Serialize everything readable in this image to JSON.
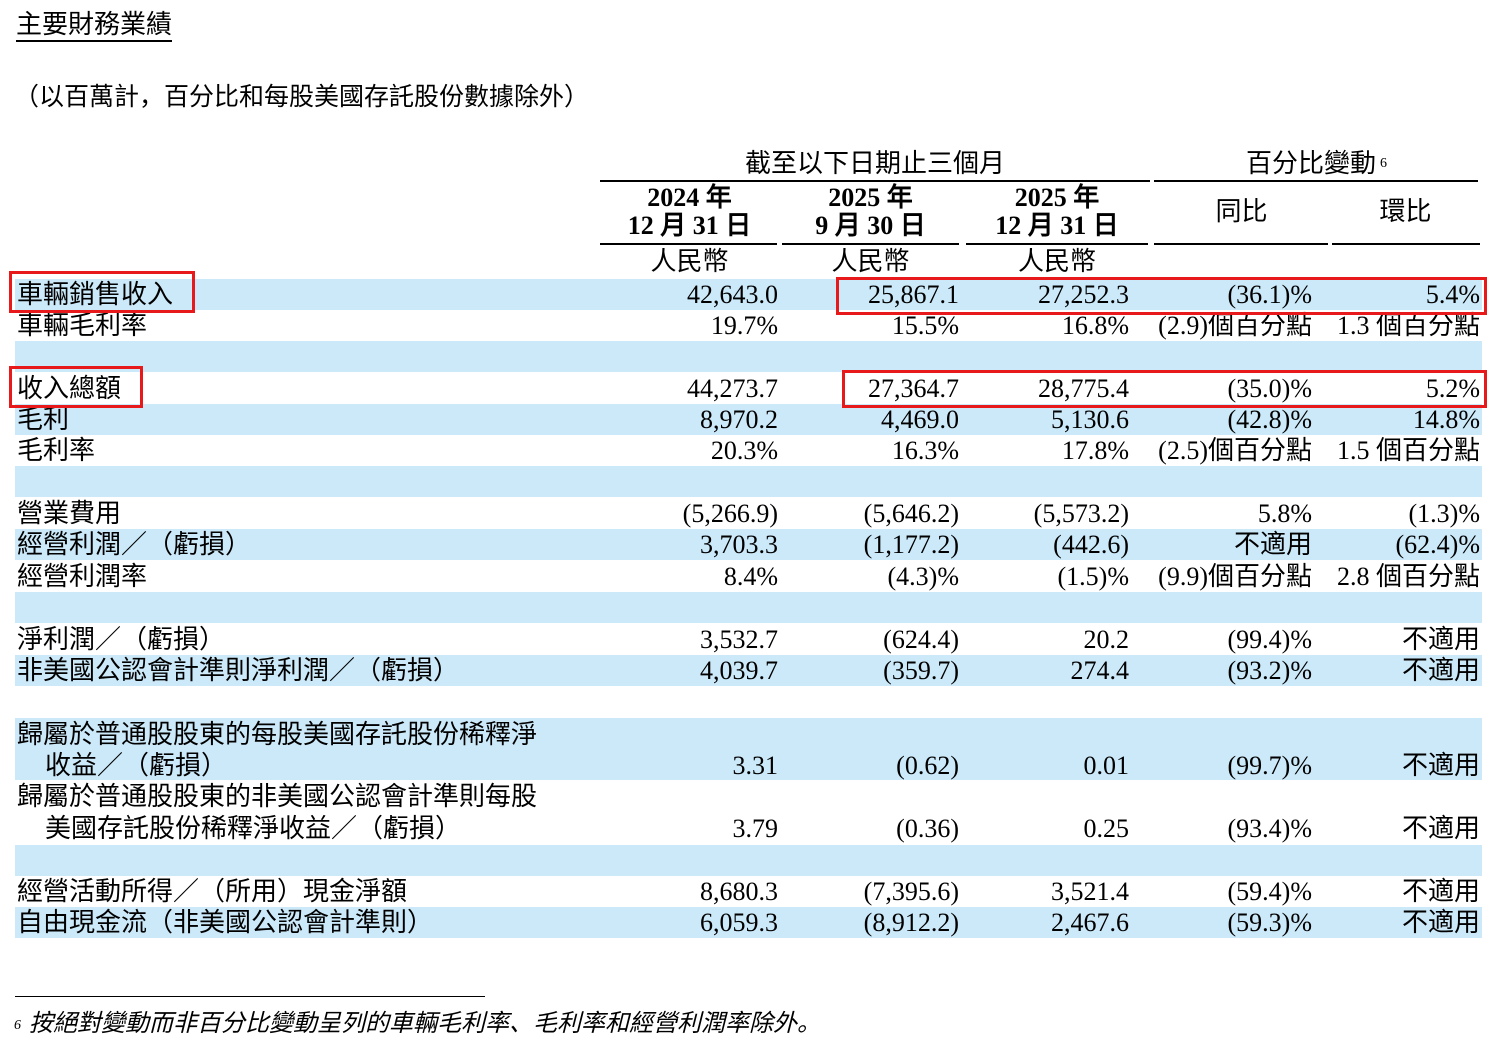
{
  "title": "主要財務業績",
  "subtitle": "（以百萬計，百分比和每股美國存託股份數據除外）",
  "header": {
    "group_period": "截至以下日期止三個月",
    "group_change": "百分比變動",
    "group_change_note": "6",
    "col1": {
      "line1": "2024 年",
      "line2": "12 月 31 日",
      "currency": "人民幣"
    },
    "col2": {
      "line1": "2025 年",
      "line2": "9 月 30 日",
      "currency": "人民幣"
    },
    "col3": {
      "line1": "2025 年",
      "line2": "12 月 31 日",
      "currency": "人民幣"
    },
    "col4": "同比",
    "col5": "環比"
  },
  "rows": [
    {
      "label": "車輛銷售收入",
      "v": [
        "42,643.0",
        "25,867.1",
        "27,252.3",
        "(36.1)%",
        "5.4%"
      ]
    },
    {
      "label": "車輛毛利率",
      "v": [
        "19.7%",
        "15.5%",
        "16.8%",
        "(2.9)個百分點",
        "1.3 個百分點"
      ]
    },
    {
      "label": "收入總額",
      "v": [
        "44,273.7",
        "27,364.7",
        "28,775.4",
        "(35.0)%",
        "5.2%"
      ]
    },
    {
      "label": "毛利",
      "v": [
        "8,970.2",
        "4,469.0",
        "5,130.6",
        "(42.8)%",
        "14.8%"
      ]
    },
    {
      "label": "毛利率",
      "v": [
        "20.3%",
        "16.3%",
        "17.8%",
        "(2.5)個百分點",
        "1.5 個百分點"
      ]
    },
    {
      "label": "營業費用",
      "v": [
        "(5,266.9)",
        "(5,646.2)",
        "(5,573.2)",
        "5.8%",
        "(1.3)%"
      ]
    },
    {
      "label": "經營利潤／（虧損）",
      "v": [
        "3,703.3",
        "(1,177.2)",
        "(442.6)",
        "不適用",
        "(62.4)%"
      ]
    },
    {
      "label": "經營利潤率",
      "v": [
        "8.4%",
        "(4.3)%",
        "(1.5)%",
        "(9.9)個百分點",
        "2.8 個百分點"
      ]
    },
    {
      "label": "淨利潤／（虧損）",
      "v": [
        "3,532.7",
        "(624.4)",
        "20.2",
        "(99.4)%",
        "不適用"
      ]
    },
    {
      "label": "非美國公認會計準則淨利潤／（虧損）",
      "v": [
        "4,039.7",
        "(359.7)",
        "274.4",
        "(93.2)%",
        "不適用"
      ]
    },
    {
      "label": "歸屬於普通股股東的每股美國存託股份稀釋淨",
      "label2": "收益／（虧損）",
      "v": [
        "3.31",
        "(0.62)",
        "0.01",
        "(99.7)%",
        "不適用"
      ]
    },
    {
      "label": "歸屬於普通股股東的非美國公認會計準則每股",
      "label2": "美國存託股份稀釋淨收益／（虧損）",
      "v": [
        "3.79",
        "(0.36)",
        "0.25",
        "(93.4)%",
        "不適用"
      ]
    },
    {
      "label": "經營活動所得／（所用）現金淨額",
      "v": [
        "8,680.3",
        "(7,395.6)",
        "3,521.4",
        "(59.4)%",
        "不適用"
      ]
    },
    {
      "label": "自由現金流（非美國公認會計準則）",
      "v": [
        "6,059.3",
        "(8,912.2)",
        "2,467.6",
        "(59.3)%",
        "不適用"
      ]
    }
  ],
  "footnote": {
    "mark": "6",
    "text": "按絕對變動而非百分比變動呈列的車輛毛利率、毛利率和經營利潤率除外。"
  },
  "highlight_color": "#e8191b",
  "band_color": "#cce9f9"
}
